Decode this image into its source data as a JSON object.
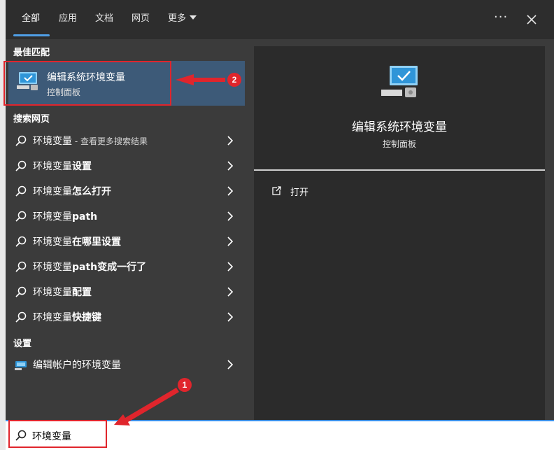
{
  "tabs": [
    {
      "label": "全部"
    },
    {
      "label": "应用"
    },
    {
      "label": "文档"
    },
    {
      "label": "网页"
    },
    {
      "label": "更多"
    }
  ],
  "best_match": {
    "section": "最佳匹配",
    "title": "编辑系统环境变量",
    "subtitle": "控制面板"
  },
  "web": {
    "section": "搜索网页",
    "first": {
      "main": "环境变量",
      "suffix": " - 查看更多搜索结果"
    },
    "items": [
      {
        "prefix": "环境变量",
        "bold": "设置"
      },
      {
        "prefix": "环境变量",
        "bold": "怎么打开"
      },
      {
        "prefix": "环境变量",
        "bold": "path"
      },
      {
        "prefix": "环境变量",
        "bold": "在哪里设置"
      },
      {
        "prefix": "环境变量",
        "bold": "path变成一行了"
      },
      {
        "prefix": "环境变量",
        "bold": "配置"
      },
      {
        "prefix": "环境变量",
        "bold": "快捷键"
      }
    ]
  },
  "settings": {
    "section": "设置",
    "item": "编辑帐户的环境变量"
  },
  "detail": {
    "title": "编辑系统环境变量",
    "subtitle": "控制面板",
    "open_label": "打开"
  },
  "search": {
    "value": "环境变量"
  },
  "annotations": {
    "badge1": "1",
    "badge2": "2"
  },
  "colors": {
    "accent": "#4f9fe6",
    "annotation_red": "#e0252c",
    "highlight": "#3d5a78"
  }
}
